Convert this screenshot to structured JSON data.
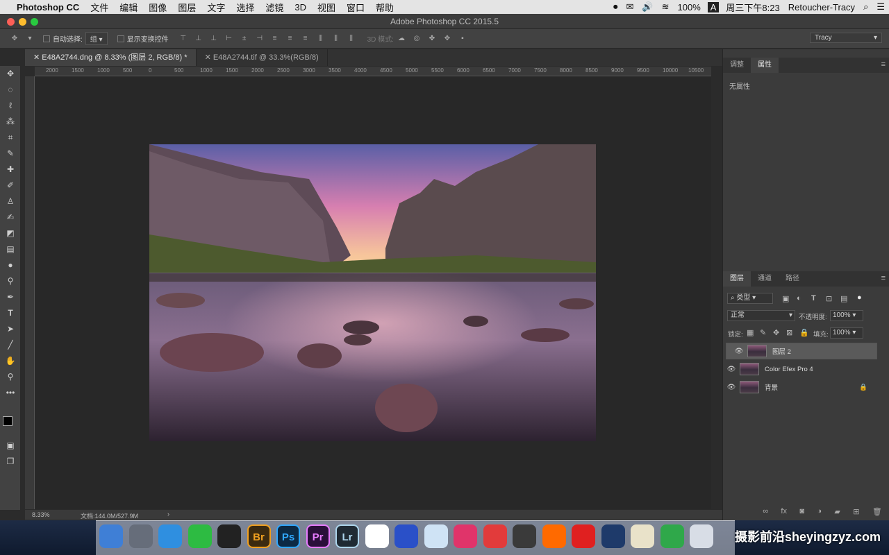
{
  "menubar": {
    "app_name": "Photoshop CC",
    "items": [
      "文件",
      "编辑",
      "图像",
      "图层",
      "文字",
      "选择",
      "滤镜",
      "3D",
      "视图",
      "窗口",
      "帮助"
    ],
    "battery": "100%",
    "input_indicator": "A",
    "clock": "周三下午8:23",
    "user": "Retoucher-Tracy"
  },
  "window": {
    "title": "Adobe Photoshop CC 2015.5"
  },
  "options": {
    "auto_select_label": "自动选择:",
    "auto_select_value": "组",
    "show_transform_label": "显示变换控件",
    "mode_3d_label": "3D 模式:",
    "workspace": "Tracy"
  },
  "tabs": [
    {
      "label": "E48A2744.dng @ 8.33% (图层 2, RGB/8) *",
      "active": true
    },
    {
      "label": "E48A2744.tif @ 33.3%(RGB/8)",
      "active": false
    }
  ],
  "ruler_labels": [
    "2000",
    "1500",
    "1000",
    "500",
    "0",
    "500",
    "1000",
    "1500",
    "2000",
    "2500",
    "3000",
    "3500",
    "4000",
    "4500",
    "5000",
    "5500",
    "6000",
    "6500",
    "7000",
    "7500",
    "8000",
    "8500",
    "9000",
    "9500",
    "10000",
    "10500"
  ],
  "status": {
    "zoom": "8.33%",
    "doc": "文档:144.0M/527.9M"
  },
  "properties_panel": {
    "tabs": [
      "调整",
      "属性"
    ],
    "content": "无属性"
  },
  "layers_panel": {
    "tabs": [
      "图层",
      "通道",
      "路径"
    ],
    "filter_label": "类型",
    "blend_mode": "正常",
    "opacity_label": "不透明度:",
    "opacity_value": "100%",
    "lock_label": "锁定:",
    "fill_label": "填充:",
    "fill_value": "100%",
    "layers": [
      {
        "name": "图层 2",
        "selected": true
      },
      {
        "name": "Color Efex Pro 4",
        "selected": false
      },
      {
        "name": "背景",
        "selected": false,
        "locked": true
      }
    ]
  },
  "dock": [
    {
      "label": "Finder",
      "color": "#3f7fd6"
    },
    {
      "label": "Launchpad",
      "color": "#666d7a"
    },
    {
      "label": "Safari",
      "color": "#2f8fe0"
    },
    {
      "label": "WeChat",
      "color": "#2dbb42"
    },
    {
      "label": "QQ",
      "color": "#222222"
    },
    {
      "label": "Br",
      "color": "#3b2a10"
    },
    {
      "label": "Ps",
      "color": "#0c2a44"
    },
    {
      "label": "Pr",
      "color": "#2a0f3a"
    },
    {
      "label": "Lr",
      "color": "#1f2a33"
    },
    {
      "label": "Baidu",
      "color": "#ffffff"
    },
    {
      "label": "Keynote",
      "color": "#2a50c8"
    },
    {
      "label": "1Password",
      "color": "#cfe3f5"
    },
    {
      "label": "DaVinci",
      "color": "#e0346a"
    },
    {
      "label": "Infuse",
      "color": "#e23b3b"
    },
    {
      "label": "OBS",
      "color": "#3a3a3a"
    },
    {
      "label": "Xiami",
      "color": "#ff6a00"
    },
    {
      "label": "NetEase",
      "color": "#e02020"
    },
    {
      "label": "QuickTime",
      "color": "#1e3a6a"
    },
    {
      "label": "TextEdit",
      "color": "#e9e2c9"
    },
    {
      "label": "Numbers",
      "color": "#2fa84a"
    },
    {
      "label": "Preview",
      "color": "#d8dde6"
    }
  ],
  "watermark": "摄影前沿sheyingzyz.com"
}
